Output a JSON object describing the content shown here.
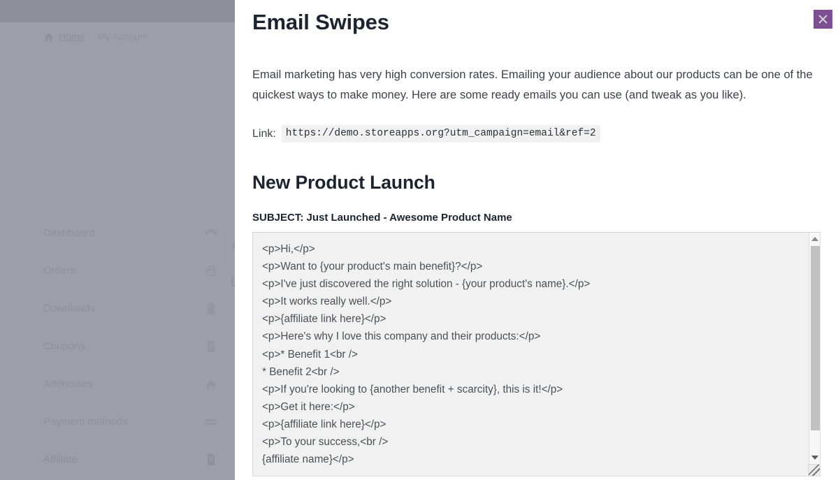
{
  "background": {
    "breadcrumb": {
      "home_icon": "home-icon",
      "home_label": "Home",
      "separator": "›",
      "current_label": "My Account"
    },
    "account_nav": [
      {
        "label": "Dashboard",
        "icon": "dashboard-gauge-icon",
        "active": false
      },
      {
        "label": "Orders",
        "icon": "shopping-basket-icon",
        "active": false
      },
      {
        "label": "Downloads",
        "icon": "download-file-icon",
        "active": false
      },
      {
        "label": "Coupons",
        "icon": "document-lines-icon",
        "active": false
      },
      {
        "label": "Addresses",
        "icon": "home-icon",
        "active": false
      },
      {
        "label": "Payment methods",
        "icon": "credit-card-icon",
        "active": false
      },
      {
        "label": "Affiliate",
        "icon": "document-icon",
        "active": true
      }
    ],
    "partial_card_text": "R",
    "partial_row_text": "E"
  },
  "modal": {
    "title": "Email Swipes",
    "close_icon": "close-x-icon",
    "close_color": "#7d4f92",
    "intro": "Email marketing has very high conversion rates. Emailing your audience about our products can be one of the quickest ways to make money. Here are some ready emails you can use (and tweak as you like).",
    "link": {
      "label": "Link:",
      "value": "https://demo.storeapps.org?utm_campaign=email&ref=2"
    },
    "swipe": {
      "heading": "New Product Launch",
      "subject": "SUBJECT: Just Launched - Awesome Product Name",
      "body": "<p>Hi,</p>\n<p>Want to {your product's main benefit}?</p>\n<p>I've just discovered the right solution - {your product's name}.</p>\n<p>It works really well.</p>\n<p>{affiliate link here}</p>\n<p>Here's why I love this company and their products:</p>\n<p>* Benefit 1<br />\n* Benefit 2<br />\n<p>If you're looking to {another benefit + scarcity}, this is it!</p>\n<p>Get it here:</p>\n<p>{affiliate link here}</p>\n<p>To your success,<br />\n{affiliate name}</p>",
      "scrollbar": {
        "up_arrow_icon": "caret-up-icon",
        "down_arrow_icon": "caret-down-icon",
        "resize_handle_icon": "resize-grip-icon"
      }
    }
  }
}
